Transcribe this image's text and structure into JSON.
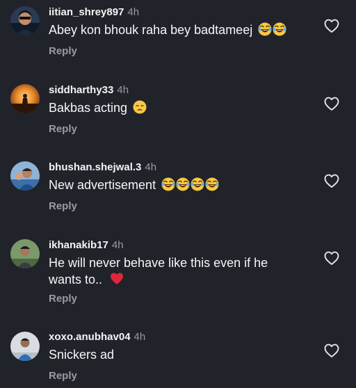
{
  "comments": [
    {
      "username": "iitian_shrey897",
      "time": "4h",
      "text": "Abey kon bhouk raha bey badtameej",
      "emojis": [
        "laugh-cry",
        "laugh-cry"
      ],
      "reply": "Reply"
    },
    {
      "username": "siddharthy33",
      "time": "4h",
      "text": "Bakbas acting",
      "emojis": [
        "unamused"
      ],
      "reply": "Reply"
    },
    {
      "username": "bhushan.shejwal.3",
      "time": "4h",
      "text": "New advertisement",
      "emojis": [
        "laugh-cry",
        "laugh-cry",
        "laugh-cry",
        "laugh-cry"
      ],
      "reply": "Reply"
    },
    {
      "username": "ikhanakib17",
      "time": "4h",
      "text": "He will never behave like this even if he wants to..",
      "emojis": [
        "red-heart"
      ],
      "reply": "Reply"
    },
    {
      "username": "xoxo.anubhav04",
      "time": "4h",
      "text": "Snickers ad",
      "emojis": [],
      "reply": "Reply"
    }
  ],
  "colors": {
    "background": "#21232b",
    "secondary_text": "#9a9ca3",
    "heart": "#e0263a"
  }
}
